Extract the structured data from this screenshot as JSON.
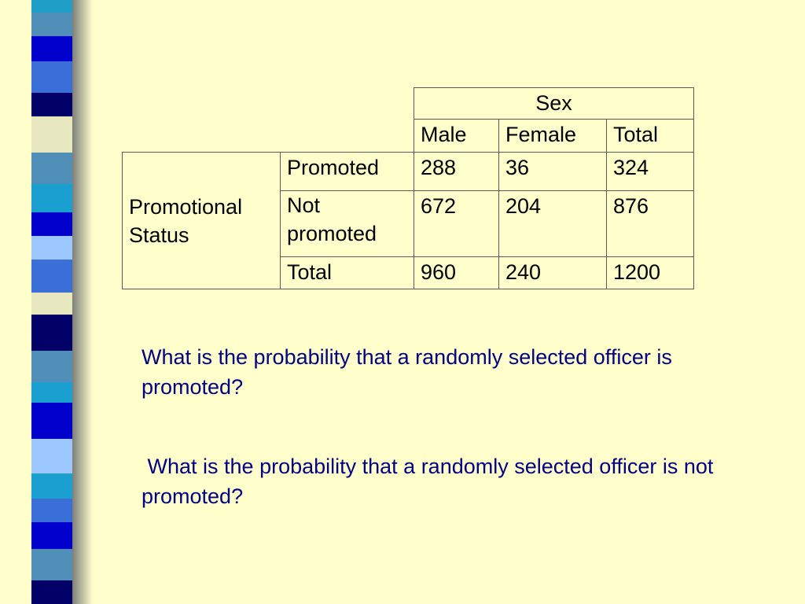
{
  "colors": {
    "background": "#FFFFCC",
    "question_text": "#000080",
    "table_text": "#000000",
    "table_border": "#5a5a5a"
  },
  "table": {
    "column_group_header": "Sex",
    "column_headers": [
      "Male",
      "Female",
      "Total"
    ],
    "row_group_header": "Promotional Status",
    "rows": [
      {
        "label": "Promoted",
        "values": [
          "288",
          "36",
          "324"
        ]
      },
      {
        "label": "Not promoted",
        "values": [
          "672",
          "204",
          "876"
        ]
      },
      {
        "label": "Total",
        "values": [
          "960",
          "240",
          "1200"
        ]
      }
    ]
  },
  "questions": [
    "What is the probability that a randomly selected officer is promoted?",
    " What is the probability that a randomly selected officer is not promoted?"
  ]
}
